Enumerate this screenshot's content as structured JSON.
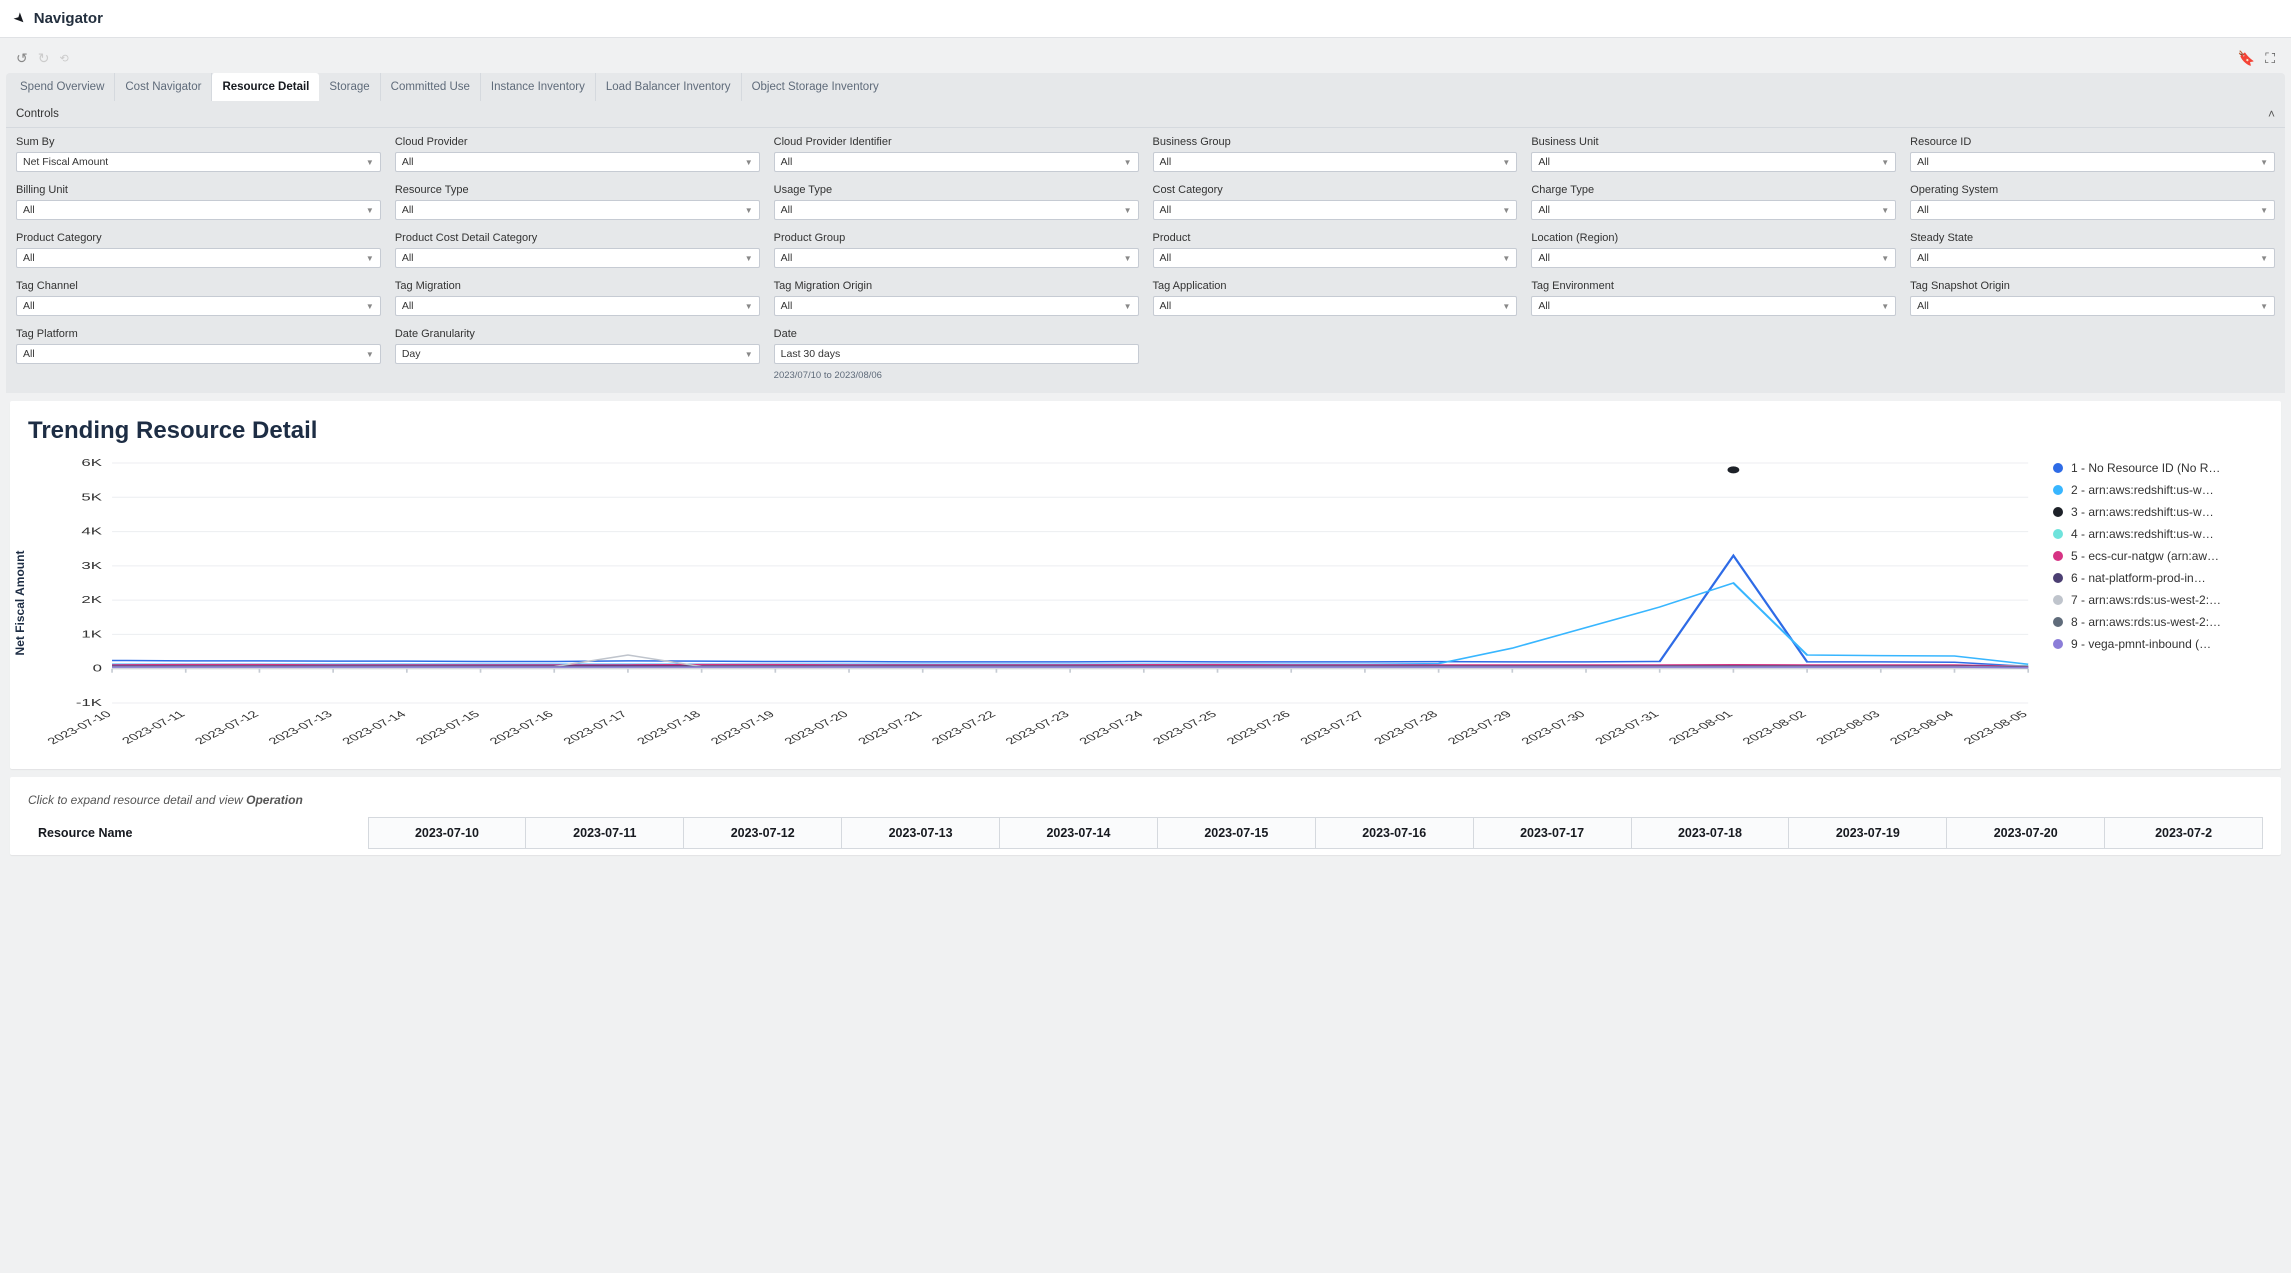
{
  "header": {
    "title": "Navigator"
  },
  "tabs": [
    {
      "label": "Spend Overview",
      "active": false
    },
    {
      "label": "Cost Navigator",
      "active": false
    },
    {
      "label": "Resource Detail",
      "active": true
    },
    {
      "label": "Storage",
      "active": false
    },
    {
      "label": "Committed Use",
      "active": false
    },
    {
      "label": "Instance Inventory",
      "active": false
    },
    {
      "label": "Load Balancer Inventory",
      "active": false
    },
    {
      "label": "Object Storage Inventory",
      "active": false
    }
  ],
  "controls_title": "Controls",
  "filters": [
    {
      "label": "Sum By",
      "value": "Net Fiscal Amount"
    },
    {
      "label": "Cloud Provider",
      "value": "All"
    },
    {
      "label": "Cloud Provider Identifier",
      "value": "All"
    },
    {
      "label": "Business Group",
      "value": "All"
    },
    {
      "label": "Business Unit",
      "value": "All"
    },
    {
      "label": "Resource ID",
      "value": "All"
    },
    {
      "label": "Billing Unit",
      "value": "All"
    },
    {
      "label": "Resource Type",
      "value": "All"
    },
    {
      "label": "Usage Type",
      "value": "All"
    },
    {
      "label": "Cost Category",
      "value": "All"
    },
    {
      "label": "Charge Type",
      "value": "All"
    },
    {
      "label": "Operating System",
      "value": "All"
    },
    {
      "label": "Product Category",
      "value": "All"
    },
    {
      "label": "Product Cost Detail Category",
      "value": "All"
    },
    {
      "label": "Product Group",
      "value": "All"
    },
    {
      "label": "Product",
      "value": "All"
    },
    {
      "label": "Location (Region)",
      "value": "All"
    },
    {
      "label": "Steady State",
      "value": "All"
    },
    {
      "label": "Tag Channel",
      "value": "All"
    },
    {
      "label": "Tag Migration",
      "value": "All"
    },
    {
      "label": "Tag Migration Origin",
      "value": "All"
    },
    {
      "label": "Tag Application",
      "value": "All"
    },
    {
      "label": "Tag Environment",
      "value": "All"
    },
    {
      "label": "Tag Snapshot Origin",
      "value": "All"
    },
    {
      "label": "Tag Platform",
      "value": "All"
    },
    {
      "label": "Date Granularity",
      "value": "Day"
    },
    {
      "label": "Date",
      "value": "Last 30 days",
      "helper": "2023/07/10 to 2023/08/06",
      "input": true
    }
  ],
  "chart_card": {
    "title": "Trending Resource Detail",
    "y_axis_label": "Net Fiscal Amount"
  },
  "chart_data": {
    "type": "line",
    "xlabel": "",
    "ylabel": "Net Fiscal Amount",
    "ylim": [
      -1000,
      6000
    ],
    "y_ticks": [
      "-1K",
      "0",
      "1K",
      "2K",
      "3K",
      "4K",
      "5K",
      "6K"
    ],
    "categories": [
      "2023-07-10",
      "2023-07-11",
      "2023-07-12",
      "2023-07-13",
      "2023-07-14",
      "2023-07-15",
      "2023-07-16",
      "2023-07-17",
      "2023-07-18",
      "2023-07-19",
      "2023-07-20",
      "2023-07-21",
      "2023-07-22",
      "2023-07-23",
      "2023-07-24",
      "2023-07-25",
      "2023-07-26",
      "2023-07-27",
      "2023-07-28",
      "2023-07-29",
      "2023-07-30",
      "2023-07-31",
      "2023-08-01",
      "2023-08-02",
      "2023-08-03",
      "2023-08-04",
      "2023-08-05"
    ],
    "series": [
      {
        "name": "1 - No Resource ID (No R…",
        "color": "#2e6be6",
        "values": [
          240,
          230,
          230,
          220,
          220,
          210,
          210,
          230,
          220,
          210,
          210,
          200,
          200,
          200,
          210,
          200,
          200,
          200,
          205,
          200,
          200,
          210,
          3300,
          200,
          200,
          190,
          70
        ]
      },
      {
        "name": "2 - arn:aws:redshift:us-w…",
        "color": "#38b6ff",
        "values": [
          130,
          130,
          130,
          130,
          130,
          130,
          130,
          130,
          130,
          130,
          130,
          130,
          130,
          130,
          130,
          130,
          130,
          130,
          150,
          600,
          1200,
          1800,
          2500,
          400,
          380,
          370,
          130
        ]
      },
      {
        "name": "3 - arn:aws:redshift:us-w…",
        "color": "#1d2128",
        "values": [
          null,
          null,
          null,
          null,
          null,
          null,
          null,
          null,
          null,
          null,
          null,
          null,
          null,
          null,
          null,
          null,
          null,
          null,
          null,
          null,
          null,
          null,
          5800,
          null,
          null,
          null,
          null
        ],
        "point_only": true
      },
      {
        "name": "4 - arn:aws:redshift:us-w…",
        "color": "#6fe3dc",
        "values": [
          90,
          90,
          90,
          90,
          90,
          90,
          90,
          90,
          90,
          90,
          90,
          90,
          90,
          90,
          90,
          90,
          90,
          90,
          90,
          90,
          90,
          90,
          90,
          90,
          90,
          90,
          90
        ]
      },
      {
        "name": "5 - ecs-cur-natgw (arn:aw…",
        "color": "#d63384",
        "values": [
          110,
          120,
          120,
          110,
          110,
          110,
          110,
          110,
          120,
          120,
          110,
          110,
          110,
          110,
          115,
          120,
          110,
          110,
          110,
          110,
          110,
          110,
          115,
          110,
          110,
          110,
          65
        ]
      },
      {
        "name": "6 - nat-platform-prod-in…",
        "color": "#4b3f72",
        "values": [
          80,
          80,
          80,
          80,
          80,
          80,
          80,
          80,
          80,
          80,
          80,
          80,
          80,
          80,
          80,
          80,
          80,
          80,
          80,
          80,
          80,
          80,
          80,
          80,
          80,
          80,
          50
        ]
      },
      {
        "name": "7 - arn:aws:rds:us-west-2:…",
        "color": "#bfc4cc",
        "values": [
          60,
          60,
          60,
          60,
          60,
          60,
          60,
          400,
          60,
          60,
          60,
          60,
          60,
          60,
          60,
          60,
          60,
          60,
          60,
          60,
          60,
          60,
          60,
          60,
          60,
          60,
          40
        ]
      },
      {
        "name": "8 - arn:aws:rds:us-west-2:…",
        "color": "#5f6b7a",
        "values": [
          55,
          55,
          55,
          55,
          55,
          55,
          55,
          55,
          55,
          55,
          55,
          55,
          55,
          55,
          55,
          55,
          55,
          55,
          55,
          55,
          55,
          55,
          55,
          55,
          55,
          55,
          35
        ]
      },
      {
        "name": "9 - vega-pmnt-inbound (…",
        "color": "#8b7dd8",
        "values": [
          45,
          45,
          45,
          45,
          45,
          45,
          45,
          45,
          45,
          45,
          45,
          45,
          45,
          45,
          45,
          45,
          45,
          45,
          45,
          45,
          45,
          45,
          45,
          45,
          45,
          45,
          30
        ]
      }
    ]
  },
  "table_section": {
    "hint_prefix": "Click to expand resource detail and view ",
    "hint_strong": "Operation",
    "resource_name_header": "Resource Name",
    "date_headers": [
      "2023-07-10",
      "2023-07-11",
      "2023-07-12",
      "2023-07-13",
      "2023-07-14",
      "2023-07-15",
      "2023-07-16",
      "2023-07-17",
      "2023-07-18",
      "2023-07-19",
      "2023-07-20",
      "2023-07-2"
    ]
  }
}
